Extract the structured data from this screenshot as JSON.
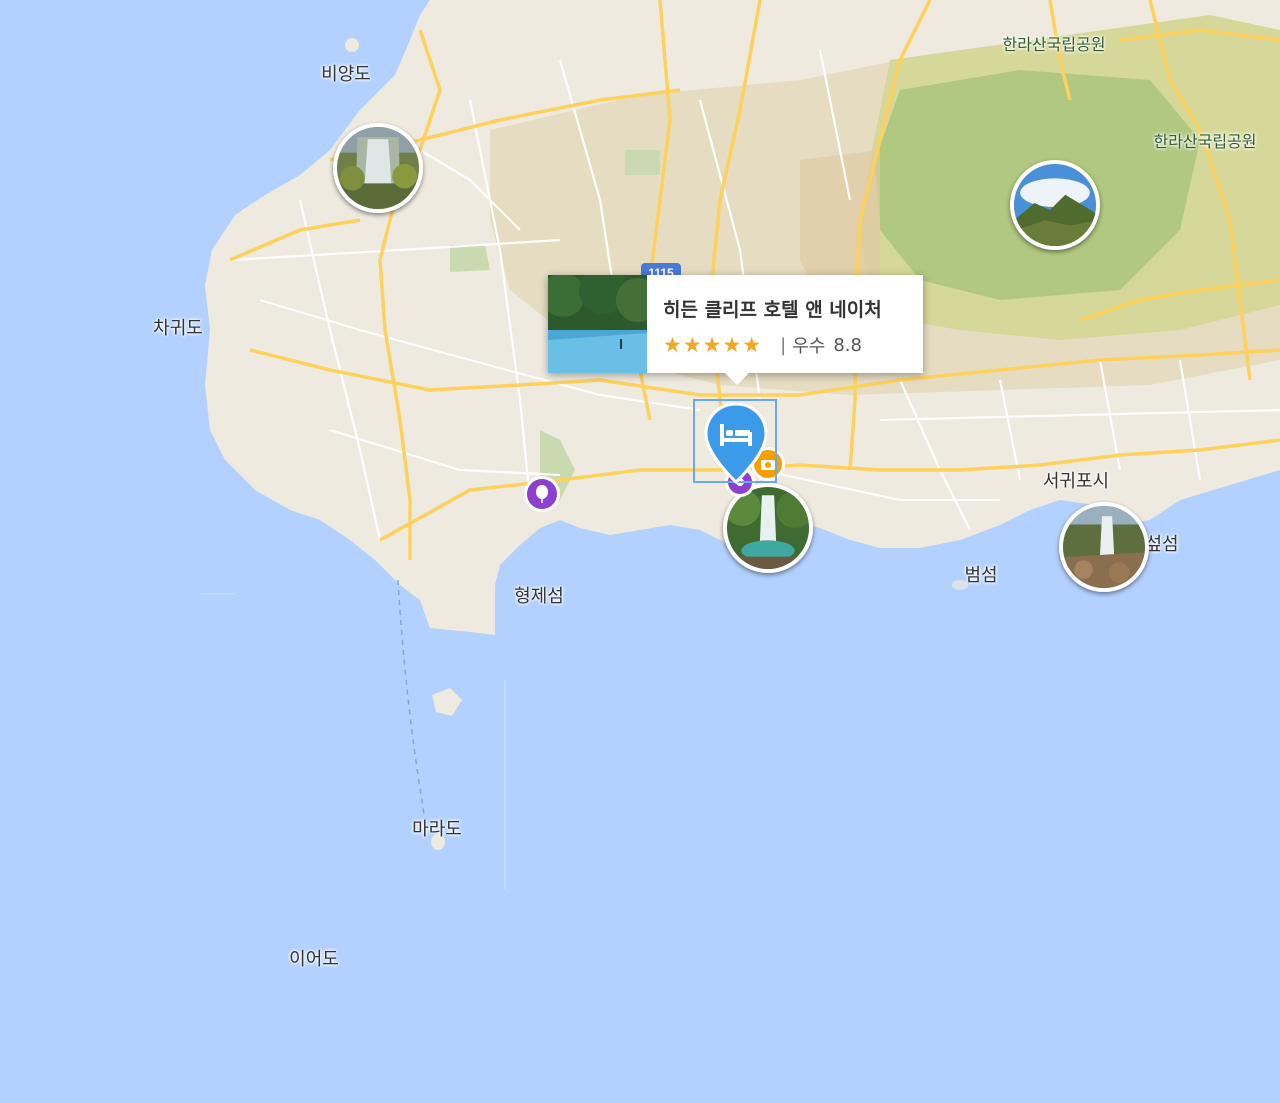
{
  "map": {
    "region": "제주도 서귀포",
    "colors": {
      "sea": "#b3d1ff",
      "land": "#efeadf",
      "park_outer": "#d6d899",
      "park_inner": "#a9c57a",
      "highlands": "#e6dcc2",
      "road_major": "#fdd15c",
      "road_minor": "#ffffff",
      "route_badge": "#4a79d8",
      "hotel_pin": "#3c9be8",
      "poi_purple": "#8d3fd0",
      "poi_orange": "#f5a000"
    },
    "route_badge": "1115",
    "place_labels": [
      {
        "key": "biyangdo",
        "text": "비양도",
        "type": "island"
      },
      {
        "key": "hallasan1",
        "text": "한라산국립공원",
        "type": "park"
      },
      {
        "key": "hallasan2",
        "text": "한라산국립공원",
        "type": "park"
      },
      {
        "key": "chagwido",
        "text": "차귀도",
        "type": "island"
      },
      {
        "key": "seogwipo",
        "text": "서귀포시",
        "type": "city"
      },
      {
        "key": "munseom",
        "text": "섶섬",
        "type": "island"
      },
      {
        "key": "beomseom",
        "text": "범섬",
        "type": "island"
      },
      {
        "key": "hyeongjeseom",
        "text": "형제섬",
        "type": "island"
      },
      {
        "key": "marado",
        "text": "마라도",
        "type": "island"
      },
      {
        "key": "ieodo",
        "text": "이어도",
        "type": "island"
      }
    ],
    "photo_markers": [
      {
        "key": "waterfall_northwest",
        "icon": "waterfall-photo"
      },
      {
        "key": "hallasan_peak",
        "icon": "mountain-photo"
      },
      {
        "key": "cheonjeyeon_falls",
        "icon": "waterfall-pool-photo"
      },
      {
        "key": "jeongbang_falls",
        "icon": "coastal-waterfall-photo"
      }
    ],
    "poi_markers": [
      {
        "key": "balloon",
        "icon": "balloon-icon",
        "color": "#8d3fd0"
      },
      {
        "key": "orange_camera",
        "icon": "camera-icon",
        "color": "#f5a000"
      },
      {
        "key": "purple_poi",
        "icon": "purple-poi-icon",
        "color": "#8d3fd0"
      }
    ]
  },
  "popup": {
    "hotel_name": "히든 클리프 호텔 앤 네이처",
    "stars": "★★★★★",
    "separator": "|",
    "grade": "우수",
    "score": "8.8",
    "thumbnail_icon": "infinity-pool-photo"
  },
  "selected_marker": {
    "icon": "bed-icon"
  }
}
